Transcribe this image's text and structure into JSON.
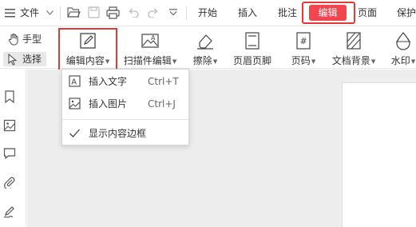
{
  "menubar": {
    "file_label": "文件",
    "tabs": [
      {
        "label": "开始"
      },
      {
        "label": "插入"
      },
      {
        "label": "批注"
      },
      {
        "label": "编辑",
        "active": true
      },
      {
        "label": "页面"
      },
      {
        "label": "保护"
      }
    ]
  },
  "ribbon": {
    "hand_mode_label": "手型",
    "select_mode_label": "选择",
    "buttons": [
      {
        "label": "编辑内容",
        "icon": "edit-content-icon"
      },
      {
        "label": "扫描件编辑",
        "icon": "scan-edit-icon"
      },
      {
        "label": "擦除",
        "icon": "eraser-icon"
      },
      {
        "label": "页眉页脚",
        "icon": "header-footer-icon"
      },
      {
        "label": "页码",
        "icon": "page-number-icon"
      },
      {
        "label": "文档背景",
        "icon": "background-icon"
      },
      {
        "label": "水印",
        "icon": "watermark-icon"
      }
    ]
  },
  "dropdown": {
    "items": [
      {
        "label": "插入文字",
        "shortcut": "Ctrl+T",
        "icon": "insert-text-icon"
      },
      {
        "label": "插入图片",
        "shortcut": "Ctrl+J",
        "icon": "insert-image-icon"
      },
      {
        "label": "显示内容边框",
        "shortcut": "",
        "icon": "checkmark-icon"
      }
    ]
  },
  "colors": {
    "accent_red": "#e53935",
    "active_tab_bg": "#f2454d",
    "doc_bg": "#ededed"
  }
}
